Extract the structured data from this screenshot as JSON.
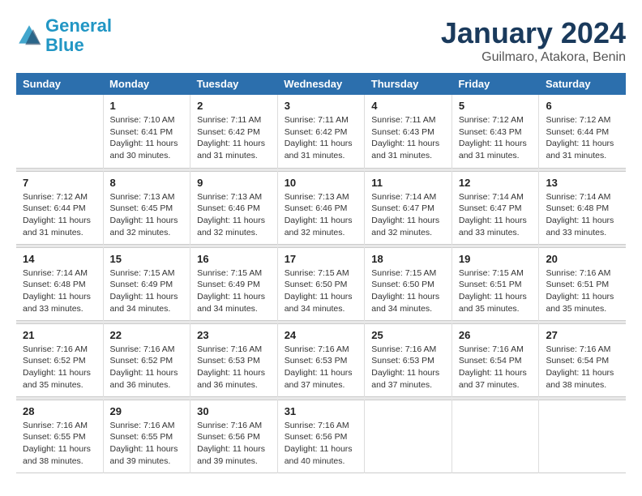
{
  "header": {
    "logo_line1": "General",
    "logo_line2": "Blue",
    "title": "January 2024",
    "subtitle": "Guilmaro, Atakora, Benin"
  },
  "columns": [
    "Sunday",
    "Monday",
    "Tuesday",
    "Wednesday",
    "Thursday",
    "Friday",
    "Saturday"
  ],
  "weeks": [
    {
      "days": [
        {
          "num": "",
          "info": ""
        },
        {
          "num": "1",
          "info": "Sunrise: 7:10 AM\nSunset: 6:41 PM\nDaylight: 11 hours\nand 30 minutes."
        },
        {
          "num": "2",
          "info": "Sunrise: 7:11 AM\nSunset: 6:42 PM\nDaylight: 11 hours\nand 31 minutes."
        },
        {
          "num": "3",
          "info": "Sunrise: 7:11 AM\nSunset: 6:42 PM\nDaylight: 11 hours\nand 31 minutes."
        },
        {
          "num": "4",
          "info": "Sunrise: 7:11 AM\nSunset: 6:43 PM\nDaylight: 11 hours\nand 31 minutes."
        },
        {
          "num": "5",
          "info": "Sunrise: 7:12 AM\nSunset: 6:43 PM\nDaylight: 11 hours\nand 31 minutes."
        },
        {
          "num": "6",
          "info": "Sunrise: 7:12 AM\nSunset: 6:44 PM\nDaylight: 11 hours\nand 31 minutes."
        }
      ]
    },
    {
      "days": [
        {
          "num": "7",
          "info": "Sunrise: 7:12 AM\nSunset: 6:44 PM\nDaylight: 11 hours\nand 31 minutes."
        },
        {
          "num": "8",
          "info": "Sunrise: 7:13 AM\nSunset: 6:45 PM\nDaylight: 11 hours\nand 32 minutes."
        },
        {
          "num": "9",
          "info": "Sunrise: 7:13 AM\nSunset: 6:46 PM\nDaylight: 11 hours\nand 32 minutes."
        },
        {
          "num": "10",
          "info": "Sunrise: 7:13 AM\nSunset: 6:46 PM\nDaylight: 11 hours\nand 32 minutes."
        },
        {
          "num": "11",
          "info": "Sunrise: 7:14 AM\nSunset: 6:47 PM\nDaylight: 11 hours\nand 32 minutes."
        },
        {
          "num": "12",
          "info": "Sunrise: 7:14 AM\nSunset: 6:47 PM\nDaylight: 11 hours\nand 33 minutes."
        },
        {
          "num": "13",
          "info": "Sunrise: 7:14 AM\nSunset: 6:48 PM\nDaylight: 11 hours\nand 33 minutes."
        }
      ]
    },
    {
      "days": [
        {
          "num": "14",
          "info": "Sunrise: 7:14 AM\nSunset: 6:48 PM\nDaylight: 11 hours\nand 33 minutes."
        },
        {
          "num": "15",
          "info": "Sunrise: 7:15 AM\nSunset: 6:49 PM\nDaylight: 11 hours\nand 34 minutes."
        },
        {
          "num": "16",
          "info": "Sunrise: 7:15 AM\nSunset: 6:49 PM\nDaylight: 11 hours\nand 34 minutes."
        },
        {
          "num": "17",
          "info": "Sunrise: 7:15 AM\nSunset: 6:50 PM\nDaylight: 11 hours\nand 34 minutes."
        },
        {
          "num": "18",
          "info": "Sunrise: 7:15 AM\nSunset: 6:50 PM\nDaylight: 11 hours\nand 34 minutes."
        },
        {
          "num": "19",
          "info": "Sunrise: 7:15 AM\nSunset: 6:51 PM\nDaylight: 11 hours\nand 35 minutes."
        },
        {
          "num": "20",
          "info": "Sunrise: 7:16 AM\nSunset: 6:51 PM\nDaylight: 11 hours\nand 35 minutes."
        }
      ]
    },
    {
      "days": [
        {
          "num": "21",
          "info": "Sunrise: 7:16 AM\nSunset: 6:52 PM\nDaylight: 11 hours\nand 35 minutes."
        },
        {
          "num": "22",
          "info": "Sunrise: 7:16 AM\nSunset: 6:52 PM\nDaylight: 11 hours\nand 36 minutes."
        },
        {
          "num": "23",
          "info": "Sunrise: 7:16 AM\nSunset: 6:53 PM\nDaylight: 11 hours\nand 36 minutes."
        },
        {
          "num": "24",
          "info": "Sunrise: 7:16 AM\nSunset: 6:53 PM\nDaylight: 11 hours\nand 37 minutes."
        },
        {
          "num": "25",
          "info": "Sunrise: 7:16 AM\nSunset: 6:53 PM\nDaylight: 11 hours\nand 37 minutes."
        },
        {
          "num": "26",
          "info": "Sunrise: 7:16 AM\nSunset: 6:54 PM\nDaylight: 11 hours\nand 37 minutes."
        },
        {
          "num": "27",
          "info": "Sunrise: 7:16 AM\nSunset: 6:54 PM\nDaylight: 11 hours\nand 38 minutes."
        }
      ]
    },
    {
      "days": [
        {
          "num": "28",
          "info": "Sunrise: 7:16 AM\nSunset: 6:55 PM\nDaylight: 11 hours\nand 38 minutes."
        },
        {
          "num": "29",
          "info": "Sunrise: 7:16 AM\nSunset: 6:55 PM\nDaylight: 11 hours\nand 39 minutes."
        },
        {
          "num": "30",
          "info": "Sunrise: 7:16 AM\nSunset: 6:56 PM\nDaylight: 11 hours\nand 39 minutes."
        },
        {
          "num": "31",
          "info": "Sunrise: 7:16 AM\nSunset: 6:56 PM\nDaylight: 11 hours\nand 40 minutes."
        },
        {
          "num": "",
          "info": ""
        },
        {
          "num": "",
          "info": ""
        },
        {
          "num": "",
          "info": ""
        }
      ]
    }
  ]
}
